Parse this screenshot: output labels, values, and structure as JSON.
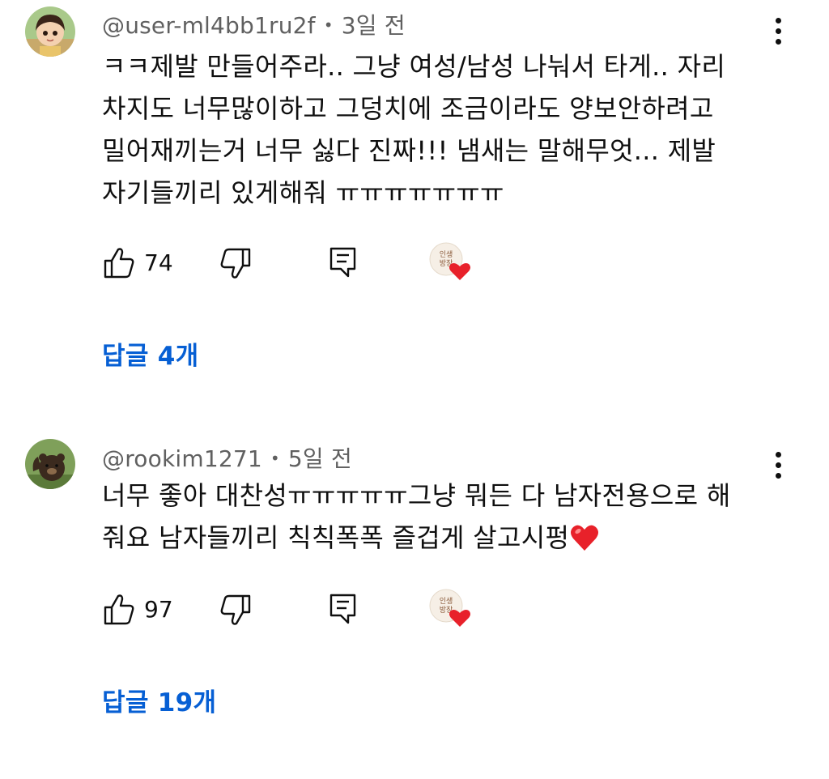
{
  "comments": [
    {
      "author": "@user-ml4bb1ru2f",
      "time": "3일 전",
      "text": "ㅋㅋ제발 만들어주라.. 그냥 여성/남성 나눠서 타게.. 자리\n차지도 너무많이하고 그덩치에 조금이라도 양보안하려고\n밀어재끼는거 너무 싫다 진짜!!! 냄새는 말해무엇... 제발\n자기들끼리 있게해줘 ㅠㅠㅠㅠㅠㅠㅠ",
      "likes": "74",
      "replies": "답글 4개"
    },
    {
      "author": "@rookim1271",
      "time": "5일 전",
      "text": "너무 좋아 대찬성ㅠㅠㅠㅠㅠ그냥 뭐든 다 남자전용으로 해\n줘요 남자들끼리 칙칙폭폭 즐겁게 살고시펑",
      "text_emoji": "heart",
      "likes": "97",
      "replies": "답글 19개"
    }
  ],
  "icons": {
    "like": "thumbs-up-icon",
    "dislike": "thumbs-down-icon",
    "reply": "reply-icon",
    "creator_heart": "creator-heart-icon",
    "more": "more-vertical-icon"
  },
  "colors": {
    "link_blue": "#065fd4",
    "heart_red": "#e8212a",
    "meta_gray": "#606060"
  },
  "creator_badge_text": "인생 방장"
}
